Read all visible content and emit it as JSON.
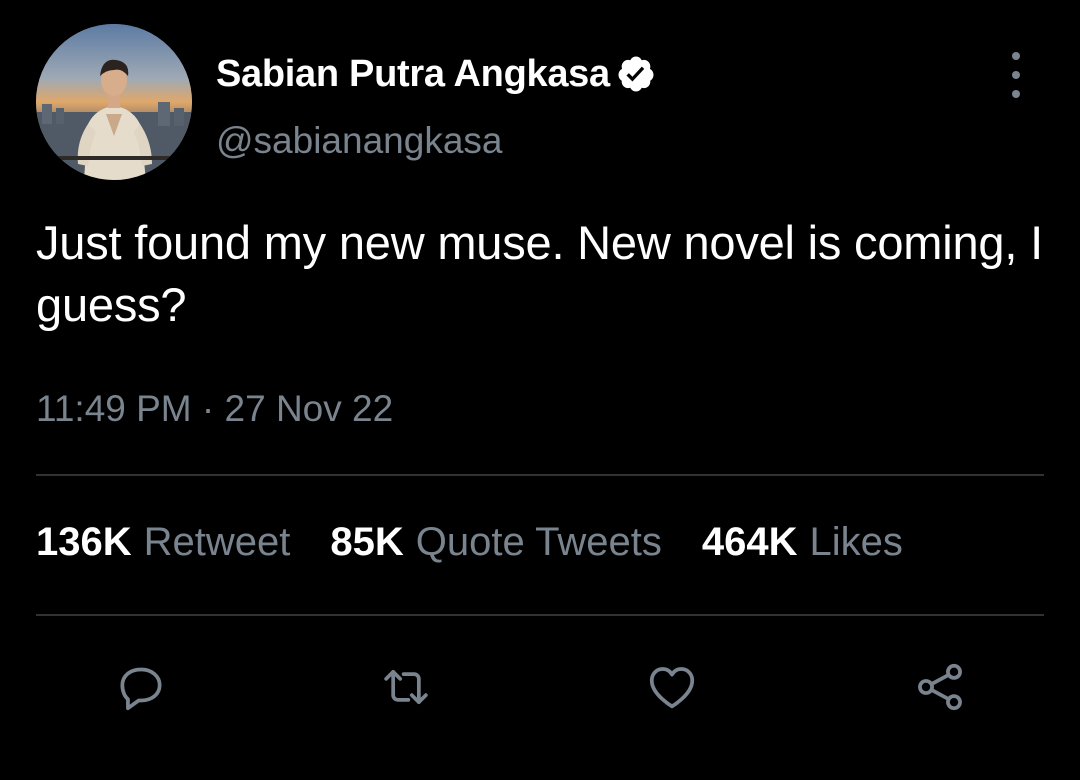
{
  "tweet": {
    "display_name": "Sabian Putra Angkasa",
    "handle": "@sabianangkasa",
    "text": "Just found my new muse. New novel is coming, I guess?",
    "timestamp": "11:49 PM · 27 Nov 22",
    "verified": true
  },
  "stats": {
    "retweets": {
      "count": "136K",
      "label": "Retweet"
    },
    "quotes": {
      "count": "85K",
      "label": "Quote Tweets"
    },
    "likes": {
      "count": "464K",
      "label": "Likes"
    }
  },
  "actions": [
    {
      "name": "reply",
      "icon": "speech-bubble-icon"
    },
    {
      "name": "retweet",
      "icon": "retweet-icon"
    },
    {
      "name": "like",
      "icon": "heart-icon"
    },
    {
      "name": "share",
      "icon": "share-icon"
    }
  ],
  "colors": {
    "background": "#000000",
    "text_primary": "#ffffff",
    "text_secondary": "#7a848e",
    "divider": "#2f3336",
    "icon": "#7a848e"
  }
}
